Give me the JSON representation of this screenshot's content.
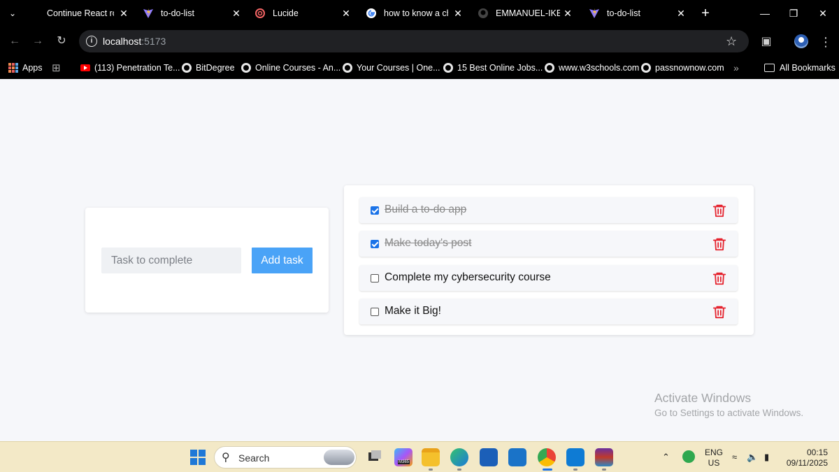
{
  "browser": {
    "tabs": [
      {
        "title": "Continue React roa",
        "icon": "document-icon"
      },
      {
        "title": "to-do-list",
        "icon": "vite-icon"
      },
      {
        "title": "Lucide",
        "icon": "lucide-icon"
      },
      {
        "title": "how to know a che",
        "icon": "google-icon"
      },
      {
        "title": "EMMANUEL-IKECH",
        "icon": "github-icon"
      },
      {
        "title": "to-do-list",
        "icon": "vite-icon"
      }
    ],
    "address": {
      "host": "localhost",
      "port": ":5173"
    },
    "bookmarks": [
      {
        "label": "Apps",
        "icon": "apps-grid-icon"
      },
      {
        "label": "(113) Penetration Te...",
        "icon": "youtube-icon"
      },
      {
        "label": "BitDegree",
        "icon": "globe-icon"
      },
      {
        "label": "Online Courses - An...",
        "icon": "globe-icon"
      },
      {
        "label": "Your Courses | One...",
        "icon": "globe-icon"
      },
      {
        "label": "15 Best Online Jobs...",
        "icon": "globe-icon"
      },
      {
        "label": "www.w3schools.com",
        "icon": "globe-icon"
      },
      {
        "label": "passnownow.com",
        "icon": "globe-icon"
      }
    ],
    "more_bookmarks": "»",
    "all_bookmarks": "All Bookmarks"
  },
  "app": {
    "input_placeholder": "Task to complete",
    "input_value": "",
    "add_button": "Add task",
    "tasks": [
      {
        "text": "Build a to-do app",
        "done": true
      },
      {
        "text": "Make today's post",
        "done": true
      },
      {
        "text": "Complete my cybersecurity course",
        "done": false
      },
      {
        "text": "Make it Big!",
        "done": false
      }
    ],
    "colors": {
      "accent": "#4aa3f7",
      "trash": "#e5232e",
      "checkbox": "#1b73e8"
    }
  },
  "watermark": {
    "title": "Activate Windows",
    "subtitle": "Go to Settings to activate Windows."
  },
  "taskbar": {
    "search_label": "Search",
    "lang_top": "ENG",
    "lang_bottom": "US",
    "time": "00:15",
    "date": "09/11/2025",
    "m365_label": "M365"
  }
}
